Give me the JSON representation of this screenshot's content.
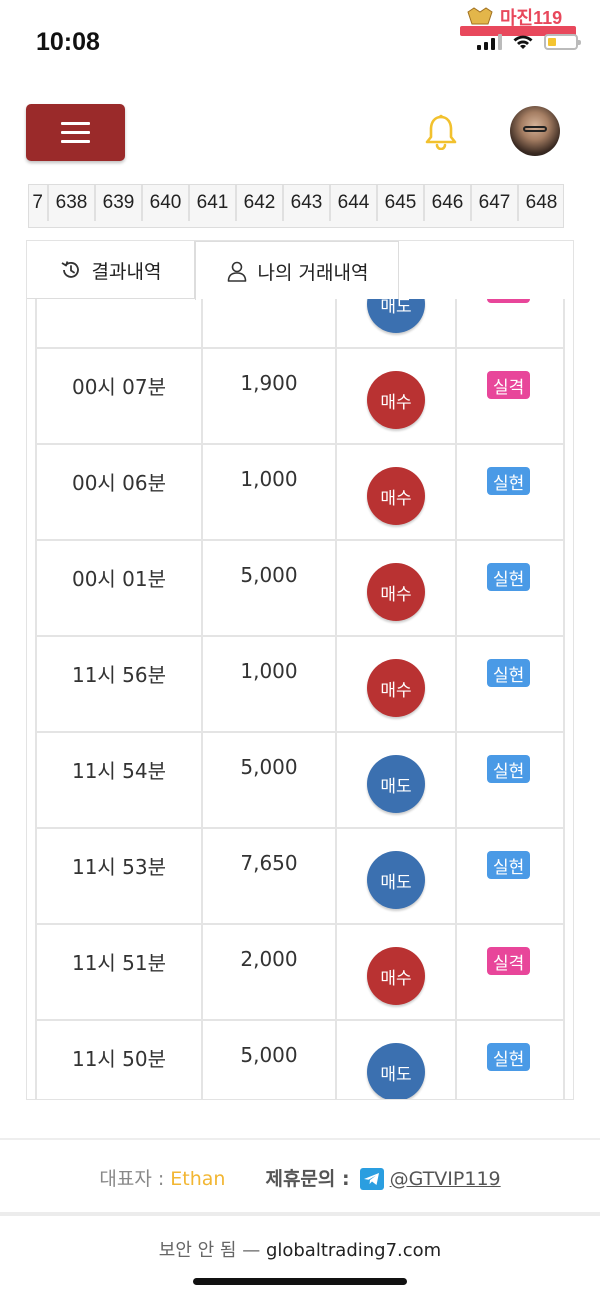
{
  "status_bar": {
    "time": "10:08",
    "watermark_text": "마진119"
  },
  "header": {},
  "number_strip": [
    "7",
    "638",
    "639",
    "640",
    "641",
    "642",
    "643",
    "644",
    "645",
    "646",
    "647",
    "648"
  ],
  "tabs": [
    {
      "label": "결과내역",
      "icon": "history-icon"
    },
    {
      "label": "나의 거래내역",
      "icon": "user-icon"
    }
  ],
  "trades": [
    {
      "time": "",
      "amount": "",
      "type": "매도",
      "kind": "sell",
      "result": "실격",
      "result_kind": "fail"
    },
    {
      "time": "00시 07분",
      "amount": "1,900",
      "type": "매수",
      "kind": "buy",
      "result": "실격",
      "result_kind": "fail"
    },
    {
      "time": "00시 06분",
      "amount": "1,000",
      "type": "매수",
      "kind": "buy",
      "result": "실현",
      "result_kind": "ok"
    },
    {
      "time": "00시 01분",
      "amount": "5,000",
      "type": "매수",
      "kind": "buy",
      "result": "실현",
      "result_kind": "ok"
    },
    {
      "time": "11시 56분",
      "amount": "1,000",
      "type": "매수",
      "kind": "buy",
      "result": "실현",
      "result_kind": "ok"
    },
    {
      "time": "11시 54분",
      "amount": "5,000",
      "type": "매도",
      "kind": "sell",
      "result": "실현",
      "result_kind": "ok"
    },
    {
      "time": "11시 53분",
      "amount": "7,650",
      "type": "매도",
      "kind": "sell",
      "result": "실현",
      "result_kind": "ok"
    },
    {
      "time": "11시 51분",
      "amount": "2,000",
      "type": "매수",
      "kind": "buy",
      "result": "실격",
      "result_kind": "fail"
    },
    {
      "time": "11시 50분",
      "amount": "5,000",
      "type": "매도",
      "kind": "sell",
      "result": "실현",
      "result_kind": "ok"
    }
  ],
  "footer": {
    "rep_label": "대표자 : ",
    "rep_name": "Ethan",
    "contact_label": "제휴문의 :",
    "contact_handle": "@GTVIP119"
  },
  "url_bar": {
    "insecure_label": "보안 안 됨 — ",
    "domain": "globaltrading7.com"
  },
  "colors": {
    "menu": "#9a2a2a",
    "buy": "#b93232",
    "sell": "#3b70b0",
    "fail": "#e8469a",
    "ok": "#4a9ae6",
    "bell": "#f2c12e",
    "rep_name": "#f2b632"
  }
}
